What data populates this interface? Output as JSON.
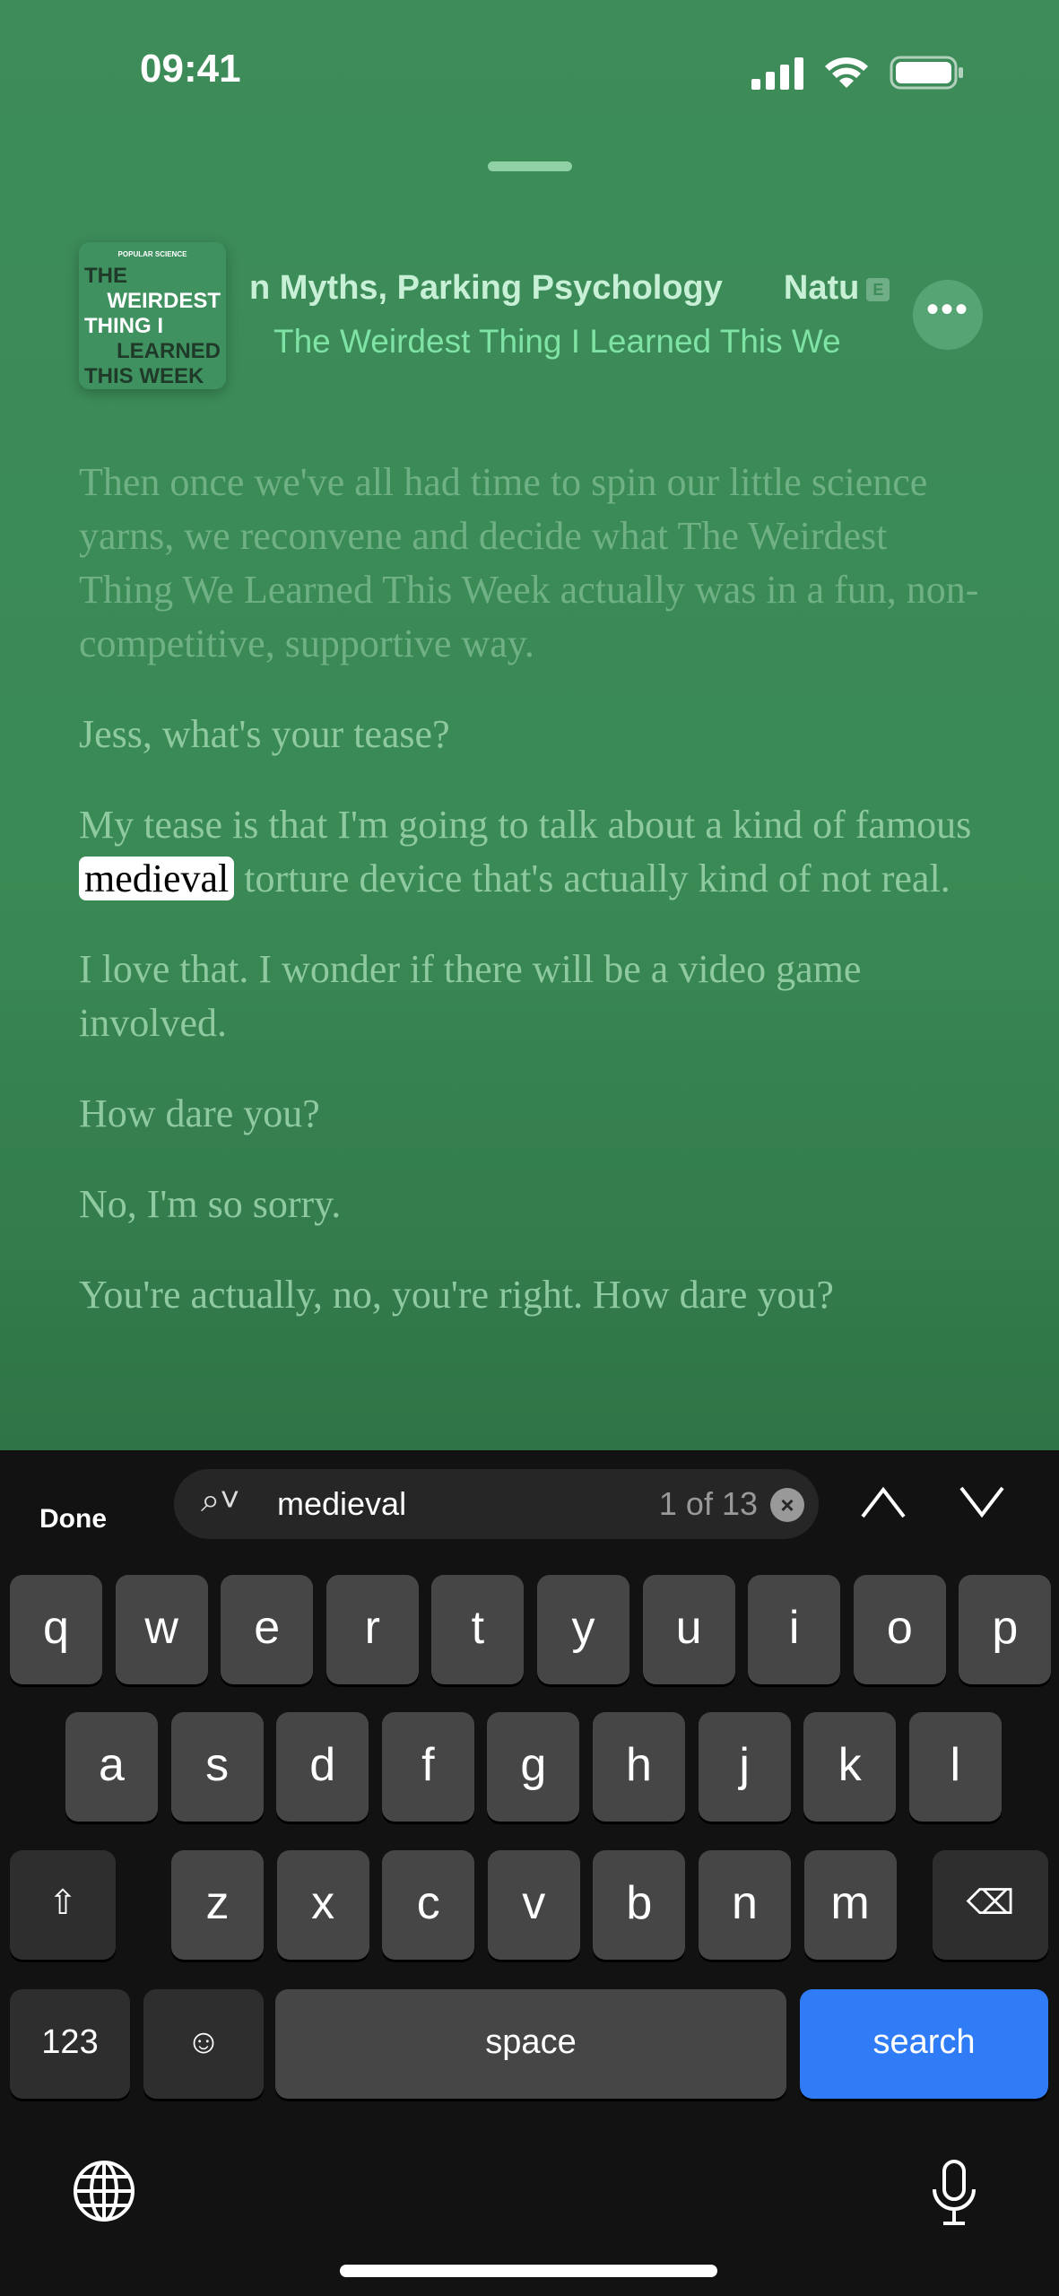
{
  "status_bar": {
    "time": "09:41",
    "icons": [
      "cellular-signal-icon",
      "wifi-icon",
      "battery-icon"
    ]
  },
  "episode": {
    "artwork": {
      "publisher": "POPULAR SCIENCE",
      "lines": [
        "THE",
        "WEIRDEST",
        "THING I",
        "LEARNED",
        "THIS WEEK"
      ]
    },
    "title_part1": "n Myths, Parking Psychology",
    "title_part2": "Natu",
    "explicit_badge": "E",
    "show": "The Weirdest Thing I Learned This We"
  },
  "transcript": {
    "paragraphs": [
      "Then once we've all had time to spin our little science yarns, we reconvene and decide what The Weirdest Thing We Learned This Week actually was in a fun, non-competitive, supportive way.",
      "Jess, what's your tease?",
      {
        "before": "My tease is that I'm going to talk about a kind of famous ",
        "match": "medieval",
        "after": " torture device that's actually kind of not real."
      },
      "I love that. I wonder if there will be a video game involved.",
      "How dare you?",
      "No, I'm so sorry.",
      "You're actually, no, you're right. How dare you?"
    ]
  },
  "find_bar": {
    "done": "Done",
    "query": "medieval",
    "count": "1 of 13"
  },
  "keyboard": {
    "row1": [
      "q",
      "w",
      "e",
      "r",
      "t",
      "y",
      "u",
      "i",
      "o",
      "p"
    ],
    "row2": [
      "a",
      "s",
      "d",
      "f",
      "g",
      "h",
      "j",
      "k",
      "l"
    ],
    "row3": [
      "z",
      "x",
      "c",
      "v",
      "b",
      "n",
      "m"
    ],
    "numbers": "123",
    "space": "space",
    "search": "search"
  },
  "colors": {
    "background": "#3a8a55",
    "accent": "#7ee3a4",
    "search_key": "#2f7cf6"
  }
}
